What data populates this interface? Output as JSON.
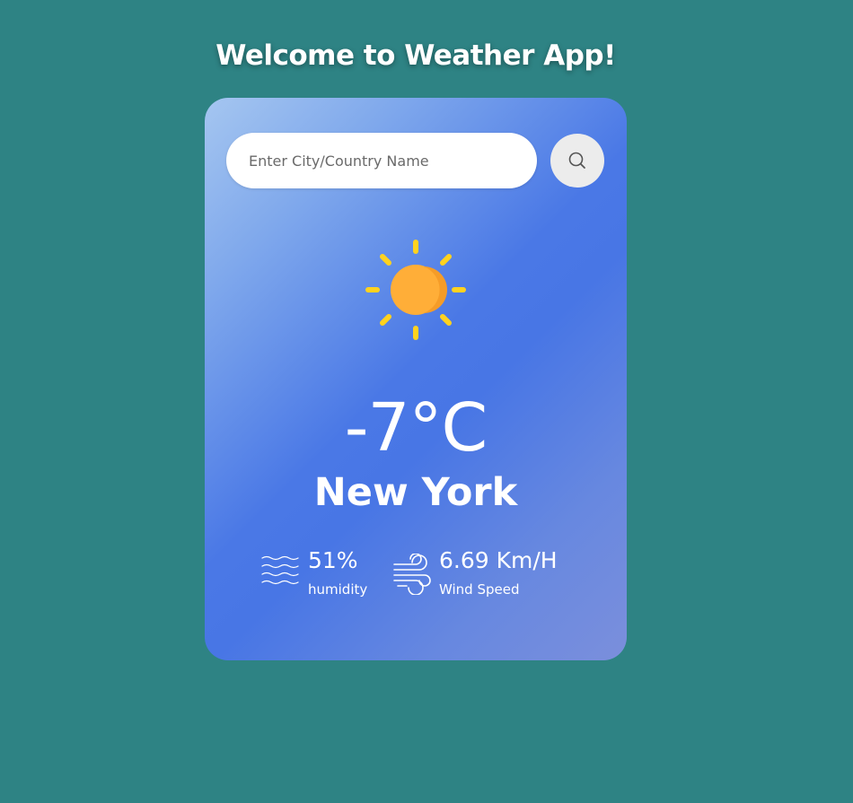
{
  "app": {
    "title": "Welcome to Weather App!"
  },
  "search": {
    "placeholder": "Enter City/Country Name",
    "value": "",
    "button_icon": "search-icon"
  },
  "weather": {
    "condition_icon": "sun-icon",
    "temperature": "-7°C",
    "city": "New York"
  },
  "details": {
    "humidity": {
      "icon": "humidity-waves-icon",
      "value": "51%",
      "label": "humidity"
    },
    "wind": {
      "icon": "wind-icon",
      "value": "6.69 Km/H",
      "label": "Wind Speed"
    }
  },
  "colors": {
    "page_background": "#2e8384",
    "card_gradient_start": "#a5c6f0",
    "card_gradient_mid": "#4a78e6",
    "card_gradient_end": "#7b8fdc",
    "sun_core": "#ffae38",
    "sun_rays": "#ffd21f",
    "text": "#ffffff"
  }
}
